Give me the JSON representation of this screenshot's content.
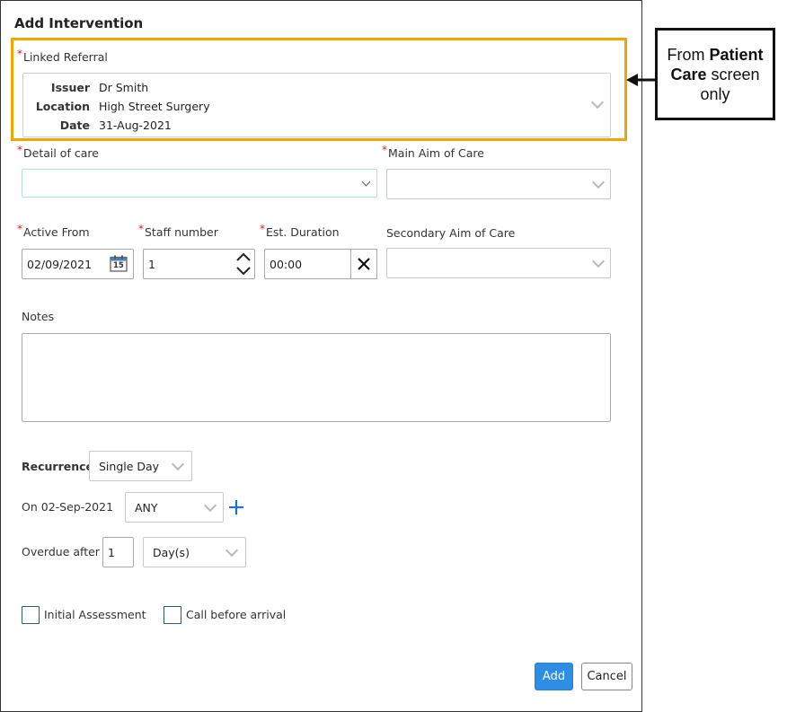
{
  "dialog": {
    "title": "Add Intervention"
  },
  "linked_referral": {
    "label": "Linked Referral",
    "required_mark": "*",
    "issuer_key": "Issuer",
    "issuer_value": "Dr Smith",
    "location_key": "Location",
    "location_value": "High Street Surgery",
    "date_key": "Date",
    "date_value": "31-Aug-2021"
  },
  "detail_of_care": {
    "label": "Detail of care",
    "value": ""
  },
  "main_aim": {
    "label": "Main Aim of Care",
    "value": ""
  },
  "active_from": {
    "label": "Active From",
    "value": "02/09/2021",
    "calendar_day": "15"
  },
  "staff_number": {
    "label": "Staff number",
    "value": "1"
  },
  "est_duration": {
    "label": "Est. Duration",
    "value": "00:00"
  },
  "secondary_aim": {
    "label": "Secondary Aim of Care",
    "value": ""
  },
  "notes": {
    "label": "Notes",
    "value": ""
  },
  "recurrence": {
    "label": "Recurrence",
    "value": "Single Day"
  },
  "on_date": {
    "label": "On 02-Sep-2021",
    "value": "ANY"
  },
  "overdue": {
    "label": "Overdue after",
    "number": "1",
    "unit": "Day(s)"
  },
  "checkboxes": {
    "initial_assessment": {
      "label": "Initial Assessment",
      "checked": false
    },
    "call_before_arrival": {
      "label": "Call before arrival",
      "checked": false
    }
  },
  "buttons": {
    "add": "Add",
    "cancel": "Cancel"
  },
  "callout": {
    "text_1": "From ",
    "bold_1": "Patient",
    "bold_2": "Care",
    "text_2": " screen",
    "text_3": "only"
  },
  "colors": {
    "highlight": "#f0a500",
    "accent": "#2e8ee6",
    "required": "#e02020",
    "plus_icon": "#1f6fd1"
  },
  "icons": {
    "chevron": "chevron-down-icon",
    "calendar": "calendar-icon",
    "spinner": "spinner-arrows-icon",
    "clear": "clear-x-icon",
    "add": "plus-icon",
    "callout_arrow": "arrow-left-icon"
  }
}
